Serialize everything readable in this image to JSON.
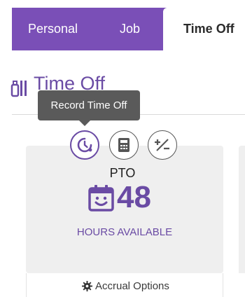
{
  "tabs": [
    {
      "label": "Personal"
    },
    {
      "label": "Job"
    },
    {
      "label": "Time Off"
    }
  ],
  "section": {
    "title": "Time Off",
    "icon": "suitcase-icon"
  },
  "tooltip": {
    "text": "Record Time Off"
  },
  "actions": [
    {
      "name": "record-time-off",
      "icon": "clock-icon"
    },
    {
      "name": "calculator",
      "icon": "calculator-icon"
    },
    {
      "name": "adjust-balance",
      "icon": "plus-minus-icon"
    }
  ],
  "card": {
    "type": "PTO",
    "balance": "48",
    "balance_label": "HOURS AVAILABLE",
    "icon": "calendar-smile-icon",
    "footer_label": "Accrual Options"
  },
  "colors": {
    "accent": "#6a4ba4",
    "tabbar": "#7a4fb7",
    "card": "#efefef"
  }
}
